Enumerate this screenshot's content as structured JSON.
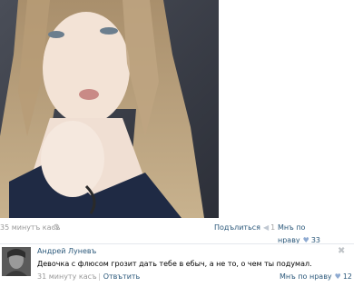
{
  "post": {
    "time": "35 минутъ касъ",
    "share_label": "Подълиться",
    "share_count": "1",
    "like_label": "Мнъ по нраву",
    "like_count": "33"
  },
  "comment": {
    "author": "Андрей Луневъ",
    "text": "Девочка с флюсом грозит дать тебе в ебыч, а не то, о чем ты подумал.",
    "time": "31 минуту касъ",
    "reply_label": "Отвътить",
    "like_label": "Мнъ по нраву",
    "like_count": "12"
  },
  "icons": {
    "settings": "gear-icon",
    "share": "megaphone-icon",
    "like": "heart-icon",
    "close": "close-icon"
  },
  "colors": {
    "link": "#2b587a",
    "muted": "#999999",
    "heart": "#8eaad1"
  }
}
